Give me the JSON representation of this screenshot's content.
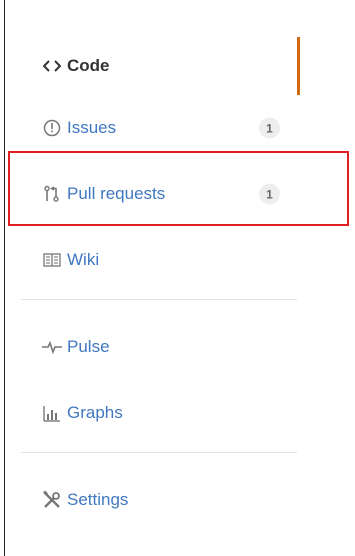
{
  "sidebar": {
    "code": {
      "label": "Code",
      "icon": "code-icon"
    },
    "issues": {
      "label": "Issues",
      "count": "1",
      "icon": "issue-icon"
    },
    "pull_requests": {
      "label": "Pull requests",
      "count": "1",
      "icon": "git-pull-request-icon"
    },
    "wiki": {
      "label": "Wiki",
      "icon": "book-icon"
    },
    "pulse": {
      "label": "Pulse",
      "icon": "pulse-icon"
    },
    "graphs": {
      "label": "Graphs",
      "icon": "graph-icon"
    },
    "settings": {
      "label": "Settings",
      "icon": "tools-icon"
    }
  },
  "colors": {
    "selected_accent": "#d26911",
    "link": "#4078c0",
    "highlight_box": "#e02020"
  }
}
